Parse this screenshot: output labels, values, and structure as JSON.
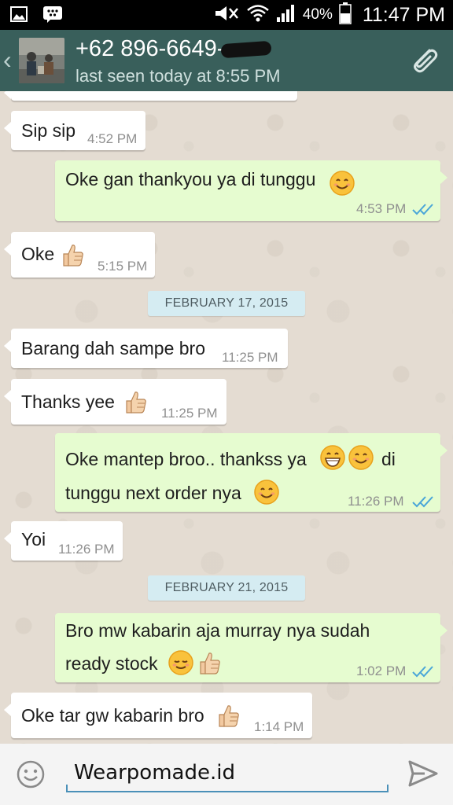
{
  "status_bar": {
    "battery": "40%",
    "time": "11:47 PM"
  },
  "header": {
    "contact": "+62 896-6649-",
    "last_seen": "last seen today at 8:55 PM"
  },
  "messages": [
    {
      "text": "Sip sip",
      "time": "4:52 PM",
      "dir": "in"
    },
    {
      "text": "Oke gan thankyou ya di tunggu",
      "time": "4:53 PM",
      "dir": "out"
    },
    {
      "text": "Oke",
      "time": "5:15 PM",
      "dir": "in"
    },
    {
      "text": "Barang dah sampe bro",
      "time": "11:25 PM",
      "dir": "in"
    },
    {
      "text": "Thanks yee",
      "time": "11:25 PM",
      "dir": "in"
    },
    {
      "line1": "Oke mantep broo.. thankss ya",
      "line1_tail": "di",
      "line2": "tunggu next order nya",
      "time": "11:26 PM",
      "dir": "out"
    },
    {
      "text": "Yoi",
      "time": "11:26 PM",
      "dir": "in"
    },
    {
      "line1": "Bro mw kabarin aja murray nya sudah",
      "line2": "ready stock",
      "time": "1:02 PM",
      "dir": "out"
    },
    {
      "text": "Oke tar gw kabarin bro",
      "time": "1:14 PM",
      "dir": "in"
    }
  ],
  "dates": [
    "FEBRUARY 17, 2015",
    "FEBRUARY 21, 2015"
  ],
  "input": {
    "value": "Wearpomade.id"
  },
  "icons": {
    "status": [
      "image-icon",
      "bbm-icon",
      "mute-icon",
      "wifi-icon",
      "signal-icon",
      "battery-icon"
    ],
    "header": [
      "back-icon",
      "avatar",
      "attach-icon"
    ],
    "input": [
      "emoji-icon",
      "send-icon"
    ]
  },
  "colors": {
    "header": "#395f5b",
    "outgoing_bubble": "#e6fcd0",
    "incoming_bubble": "#ffffff",
    "date_chip": "#d5ecf2",
    "read_ticks": "#4aa6d8"
  }
}
